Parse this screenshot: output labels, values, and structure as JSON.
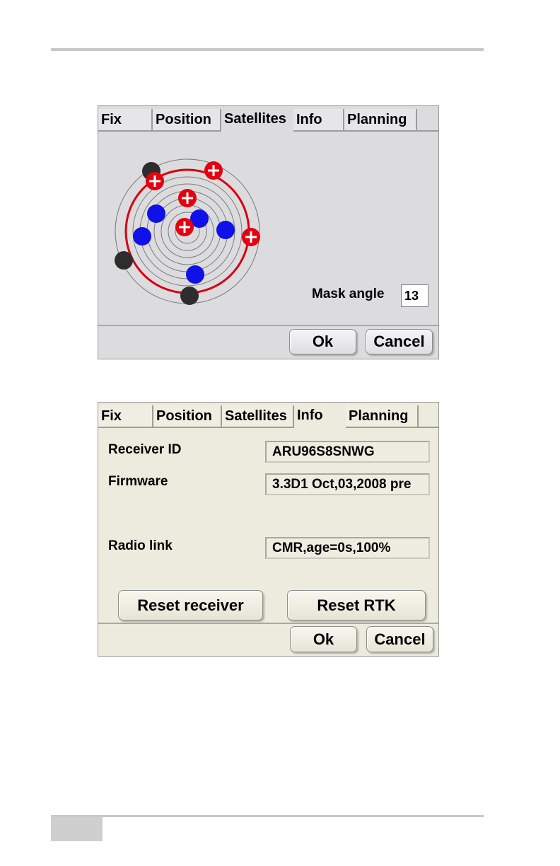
{
  "colors": {
    "used_satellite": "#e4000f",
    "tracked_satellite": "#1010e8",
    "below_mask_satellite": "#2d2d2d",
    "mask_ring": "#d80010"
  },
  "screen1": {
    "tabs": [
      "Fix",
      "Position",
      "Satellites",
      "Info",
      "Planning"
    ],
    "active_tab": "Satellites",
    "mask_angle_label": "Mask angle",
    "mask_angle_value": "13",
    "ok_label": "Ok",
    "cancel_label": "Cancel"
  },
  "screen2": {
    "tabs": [
      "Fix",
      "Position",
      "Satellites",
      "Info",
      "Planning"
    ],
    "active_tab": "Info",
    "fields": [
      {
        "label": "Receiver ID",
        "value": "ARU96S8SNWG"
      },
      {
        "label": "Firmware",
        "value": "3.3D1 Oct,03,2008 pre"
      },
      {
        "label": "Radio link",
        "value": "CMR,age=0s,100%"
      }
    ],
    "reset_receiver_label": "Reset receiver",
    "reset_rtk_label": "Reset RTK",
    "ok_label": "Ok",
    "cancel_label": "Cancel"
  }
}
